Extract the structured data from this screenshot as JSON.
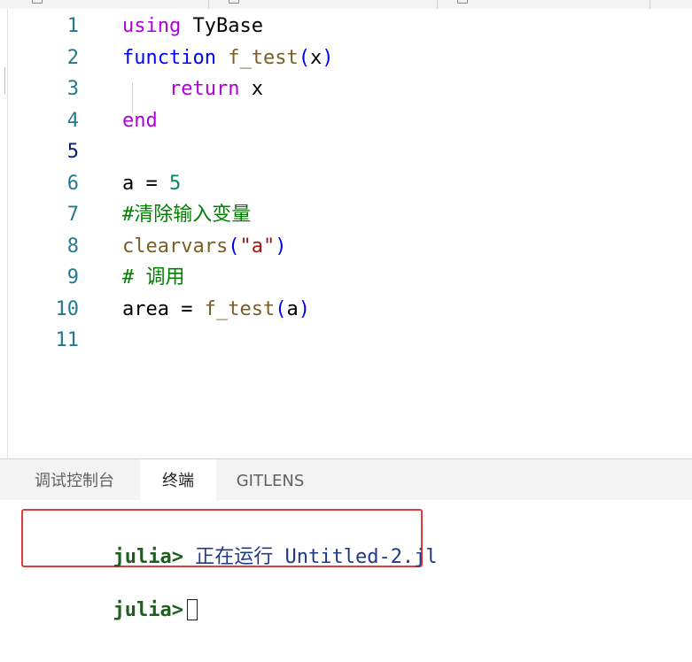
{
  "editor": {
    "lines": [
      {
        "num": "1",
        "parts": [
          [
            "kw",
            "using"
          ],
          [
            "",
            " TyBase"
          ]
        ]
      },
      {
        "num": "2",
        "parts": [
          [
            "kw2",
            "function"
          ],
          [
            "",
            " "
          ],
          [
            "fn",
            "f_test"
          ],
          [
            "kw2",
            "("
          ],
          [
            "",
            "x"
          ],
          [
            "kw2",
            ")"
          ]
        ]
      },
      {
        "num": "3",
        "parts": [
          [
            "",
            "    "
          ],
          [
            "kw",
            "return"
          ],
          [
            "",
            " x"
          ]
        ]
      },
      {
        "num": "4",
        "parts": [
          [
            "kw",
            "end"
          ]
        ]
      },
      {
        "num": "5",
        "parts": []
      },
      {
        "num": "6",
        "parts": [
          [
            "",
            "a = "
          ],
          [
            "num",
            "5"
          ]
        ]
      },
      {
        "num": "7",
        "parts": [
          [
            "cm-mono",
            "#"
          ],
          [
            "cm",
            "清除输入变量"
          ]
        ]
      },
      {
        "num": "8",
        "parts": [
          [
            "fn",
            "clearvars"
          ],
          [
            "kw2",
            "("
          ],
          [
            "str",
            "\"a\""
          ],
          [
            "kw2",
            ")"
          ]
        ]
      },
      {
        "num": "9",
        "parts": [
          [
            "cm-mono",
            "# "
          ],
          [
            "cm",
            "调用"
          ]
        ]
      },
      {
        "num": "10",
        "parts": [
          [
            "",
            "area = "
          ],
          [
            "fn",
            "f_test"
          ],
          [
            "kw2",
            "("
          ],
          [
            "",
            "a"
          ],
          [
            "kw2",
            ")"
          ]
        ]
      },
      {
        "num": "11",
        "parts": []
      }
    ],
    "current_line": "5"
  },
  "panel": {
    "tabs": [
      {
        "label": "调试控制台",
        "active": false
      },
      {
        "label": "终端",
        "active": true
      },
      {
        "label": "GITLENS",
        "active": false
      }
    ]
  },
  "terminal": {
    "line1": {
      "prompt": "julia>",
      "message": "正在运行",
      "file": "Untitled-2.jl"
    },
    "line2": {
      "prompt": "julia>"
    }
  },
  "colors": {
    "highlight_box": "#e03c3c",
    "prompt": "#1e5e1e",
    "keyword_purple": "#af00db",
    "keyword_blue": "#0000ff",
    "comment": "#008000",
    "line_number": "#237893"
  }
}
